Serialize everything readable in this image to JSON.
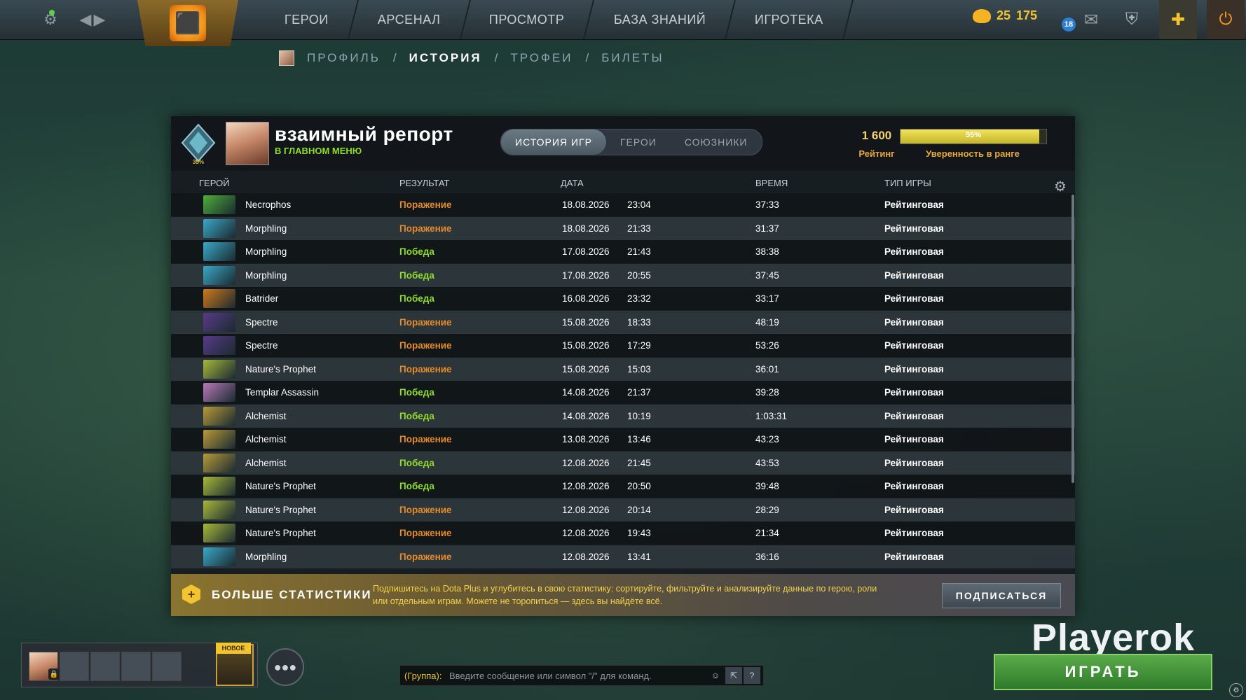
{
  "topbar": {
    "nav": [
      "ГЕРОИ",
      "АРСЕНАЛ",
      "ПРОСМОТР",
      "БАЗА ЗНАНИЙ",
      "ИГРОТЕКА"
    ],
    "currency_a": "25",
    "currency_b": "175",
    "mail_count": "18"
  },
  "breadcrumb": {
    "profile": "ПРОФИЛЬ",
    "history": "ИСТОРИЯ",
    "trophies": "ТРОФЕИ",
    "tickets": "БИЛЕТЫ",
    "sep": "/"
  },
  "profile": {
    "rank_percent": "35%",
    "username": "взаимный репорт",
    "status": "В ГЛАВНОМ МЕНЮ",
    "rating": "1 600",
    "rating_label": "Рейтинг",
    "confidence": "95%",
    "confidence_value": 0.95,
    "confidence_label": "Уверенность в ранге"
  },
  "tabs": [
    "ИСТОРИЯ ИГР",
    "ГЕРОИ",
    "СОЮЗНИКИ"
  ],
  "columns": {
    "hero": "ГЕРОЙ",
    "result": "РЕЗУЛЬТАТ",
    "date": "ДАТА",
    "time": "ВРЕМЯ",
    "mode": "ТИП ИГРЫ"
  },
  "matches": [
    {
      "hero": "Necrophos",
      "result": "Поражение",
      "win": false,
      "date": "18.08.2026",
      "time": "23:04",
      "duration": "37:33",
      "mode": "Рейтинговая",
      "color": "#4fae3a"
    },
    {
      "hero": "Morphling",
      "result": "Поражение",
      "win": false,
      "date": "18.08.2026",
      "time": "21:33",
      "duration": "31:37",
      "mode": "Рейтинговая",
      "color": "#3aa8c8"
    },
    {
      "hero": "Morphling",
      "result": "Победа",
      "win": true,
      "date": "17.08.2026",
      "time": "21:43",
      "duration": "38:38",
      "mode": "Рейтинговая",
      "color": "#3aa8c8"
    },
    {
      "hero": "Morphling",
      "result": "Победа",
      "win": true,
      "date": "17.08.2026",
      "time": "20:55",
      "duration": "37:45",
      "mode": "Рейтинговая",
      "color": "#3aa8c8"
    },
    {
      "hero": "Batrider",
      "result": "Победа",
      "win": true,
      "date": "16.08.2026",
      "time": "23:32",
      "duration": "33:17",
      "mode": "Рейтинговая",
      "color": "#d07a1a"
    },
    {
      "hero": "Spectre",
      "result": "Поражение",
      "win": false,
      "date": "15.08.2026",
      "time": "18:33",
      "duration": "48:19",
      "mode": "Рейтинговая",
      "color": "#5a3a8a"
    },
    {
      "hero": "Spectre",
      "result": "Поражение",
      "win": false,
      "date": "15.08.2026",
      "time": "17:29",
      "duration": "53:26",
      "mode": "Рейтинговая",
      "color": "#5a3a8a"
    },
    {
      "hero": "Nature's Prophet",
      "result": "Поражение",
      "win": false,
      "date": "15.08.2026",
      "time": "15:03",
      "duration": "36:01",
      "mode": "Рейтинговая",
      "color": "#a8b83a"
    },
    {
      "hero": "Templar Assassin",
      "result": "Победа",
      "win": true,
      "date": "14.08.2026",
      "time": "21:37",
      "duration": "39:28",
      "mode": "Рейтинговая",
      "color": "#b87ab8"
    },
    {
      "hero": "Alchemist",
      "result": "Победа",
      "win": true,
      "date": "14.08.2026",
      "time": "10:19",
      "duration": "1:03:31",
      "mode": "Рейтинговая",
      "color": "#b89a3a"
    },
    {
      "hero": "Alchemist",
      "result": "Поражение",
      "win": false,
      "date": "13.08.2026",
      "time": "13:46",
      "duration": "43:23",
      "mode": "Рейтинговая",
      "color": "#b89a3a"
    },
    {
      "hero": "Alchemist",
      "result": "Победа",
      "win": true,
      "date": "12.08.2026",
      "time": "21:45",
      "duration": "43:53",
      "mode": "Рейтинговая",
      "color": "#b89a3a"
    },
    {
      "hero": "Nature's Prophet",
      "result": "Победа",
      "win": true,
      "date": "12.08.2026",
      "time": "20:50",
      "duration": "39:48",
      "mode": "Рейтинговая",
      "color": "#a8b83a"
    },
    {
      "hero": "Nature's Prophet",
      "result": "Поражение",
      "win": false,
      "date": "12.08.2026",
      "time": "20:14",
      "duration": "28:29",
      "mode": "Рейтинговая",
      "color": "#a8b83a"
    },
    {
      "hero": "Nature's Prophet",
      "result": "Поражение",
      "win": false,
      "date": "12.08.2026",
      "time": "19:43",
      "duration": "21:34",
      "mode": "Рейтинговая",
      "color": "#a8b83a"
    },
    {
      "hero": "Morphling",
      "result": "Поражение",
      "win": false,
      "date": "12.08.2026",
      "time": "13:41",
      "duration": "36:16",
      "mode": "Рейтинговая",
      "color": "#3aa8c8"
    }
  ],
  "plus": {
    "title": "БОЛЬШЕ СТАТИСТИКИ",
    "description": "Подпишитесь на Dota Plus и углубитесь в свою статистику: сортируйте, фильтруйте и анализируйте данные по герою, роли или отдельным играм. Можете не торопиться — здесь вы найдёте всё.",
    "subscribe": "ПОДПИСАТЬСЯ"
  },
  "bottom": {
    "new_label": "НОВОЕ",
    "chat_group": "(Группа):",
    "chat_placeholder": "Введите сообщение или символ \"/\" для команд.",
    "chat_help": "?",
    "watermark": "Playerok",
    "play": "ИГРАТЬ"
  },
  "colors": {
    "win": "#8fdc2a",
    "loss": "#e58a2a",
    "rating": "#f3d26a",
    "accent_gold": "#f4c430",
    "play_green": "#3f8f35"
  },
  "icons": [
    "settings-gear-icon",
    "back-arrow-icon",
    "forward-arrow-icon",
    "dota-logo-icon",
    "gold-coin-icon",
    "mail-icon",
    "armory-icon",
    "dota-plus-icon",
    "power-icon",
    "table-settings-icon",
    "lock-icon",
    "friends-icon",
    "emoji-icon",
    "expand-icon",
    "info-icon"
  ]
}
